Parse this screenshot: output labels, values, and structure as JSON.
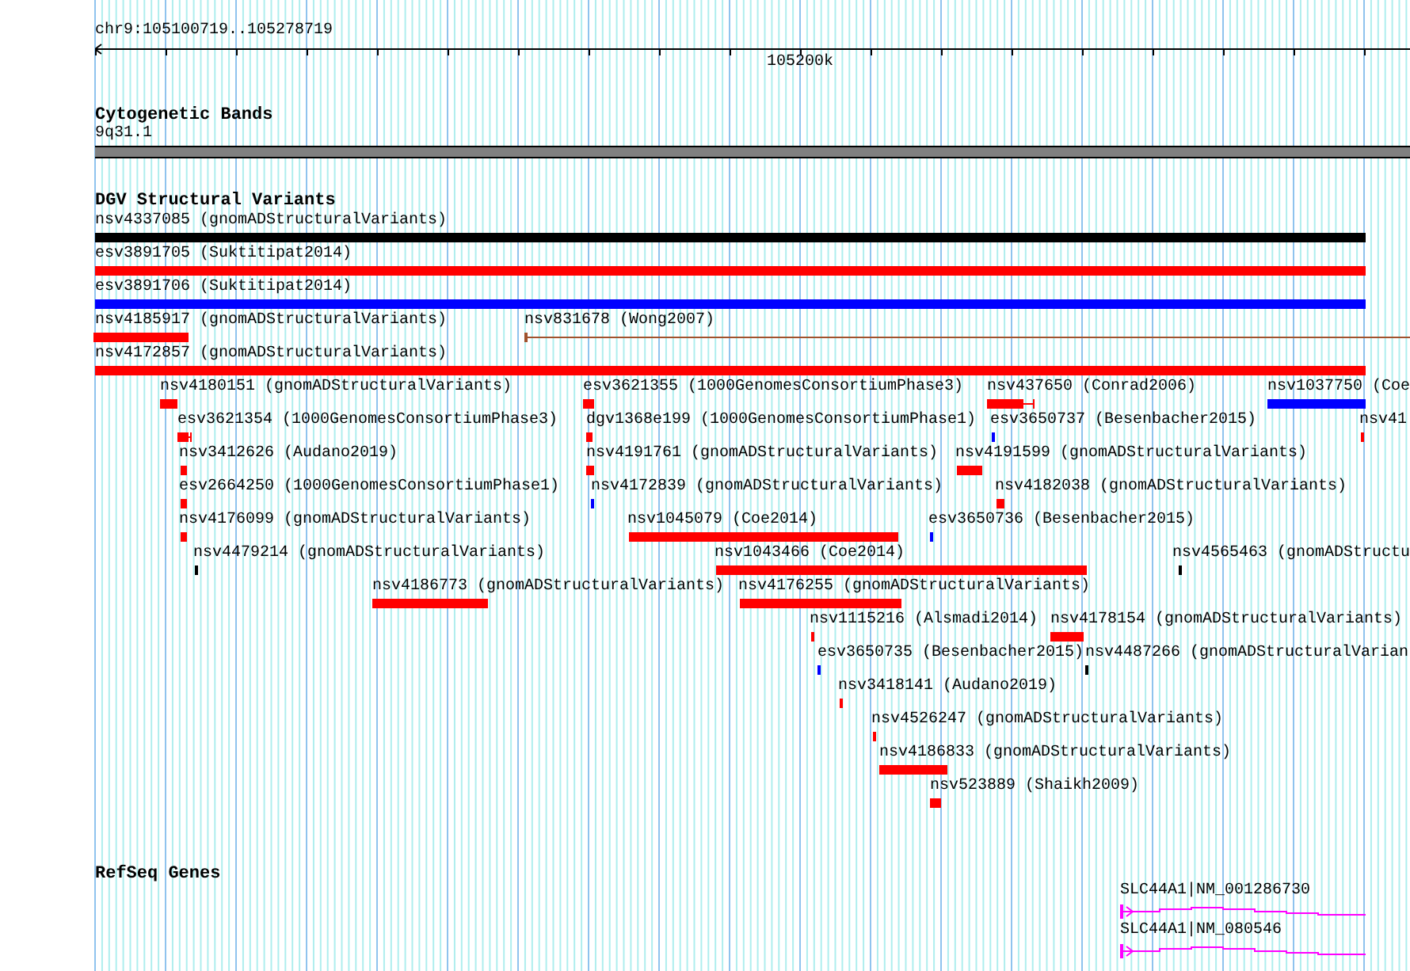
{
  "ruler": {
    "location": "chr9:105100719..105278719",
    "tick_label": "105200k"
  },
  "tracks": [
    {
      "title": "Cytogenetic Bands",
      "kind": "bands",
      "features": [
        {
          "label": "9q31.1"
        }
      ]
    },
    {
      "title": "DGV Structural Variants",
      "kind": "variants",
      "features": [
        {
          "label": "nsv4337085 (gnomADStructuralVariants)",
          "color": "#000000",
          "kind": "bar"
        },
        {
          "label": "esv3891705 (Suktitipat2014)",
          "color": "#ff0000",
          "kind": "bar"
        },
        {
          "label": "esv3891706 (Suktitipat2014)",
          "color": "#0000ff",
          "kind": "bar"
        },
        {
          "label": "nsv4185917 (gnomADStructuralVariants)",
          "color": "#ff0000",
          "kind": "bar"
        },
        {
          "label": "nsv831678 (Wong2007)",
          "color": "#a0522d",
          "kind": "line"
        },
        {
          "label": "nsv4172857 (gnomADStructuralVariants)",
          "color": "#ff0000",
          "kind": "bar"
        },
        {
          "label": "nsv4180151 (gnomADStructuralVariants)",
          "color": "#ff0000",
          "kind": "bar"
        },
        {
          "label": "esv3621355 (1000GenomesConsortiumPhase3)",
          "color": "#ff0000",
          "kind": "bar"
        },
        {
          "label": "nsv437650 (Conrad2006)",
          "color": "#ff0000",
          "kind": "whisker"
        },
        {
          "label": "nsv1037750 (Coe",
          "color": "#0000ff",
          "kind": "bar"
        },
        {
          "label": "esv3621354 (1000GenomesConsortiumPhase3)",
          "color": "#ff0000",
          "kind": "whisker"
        },
        {
          "label": "dgv1368e199 (1000GenomesConsortiumPhase1)",
          "color": "#ff0000",
          "kind": "bar"
        },
        {
          "label": "esv3650737 (Besenbacher2015)",
          "color": "#0000ff",
          "kind": "bar"
        },
        {
          "label": "nsv41",
          "color": "#ff0000",
          "kind": "bar"
        },
        {
          "label": "nsv3412626 (Audano2019)",
          "color": "#ff0000",
          "kind": "bar"
        },
        {
          "label": "nsv4191761 (gnomADStructuralVariants)",
          "color": "#ff0000",
          "kind": "bar"
        },
        {
          "label": "nsv4191599 (gnomADStructuralVariants)",
          "color": "#ff0000",
          "kind": "bar"
        },
        {
          "label": "esv2664250 (1000GenomesConsortiumPhase1)",
          "color": "#ff0000",
          "kind": "bar"
        },
        {
          "label": "nsv4172839 (gnomADStructuralVariants)",
          "color": "#0000ff",
          "kind": "bar"
        },
        {
          "label": "nsv4182038 (gnomADStructuralVariants)",
          "color": "#ff0000",
          "kind": "bar"
        },
        {
          "label": "nsv4176099 (gnomADStructuralVariants)",
          "color": "#ff0000",
          "kind": "bar"
        },
        {
          "label": "nsv1045079 (Coe2014)",
          "color": "#ff0000",
          "kind": "bar"
        },
        {
          "label": "esv3650736 (Besenbacher2015)",
          "color": "#0000ff",
          "kind": "bar"
        },
        {
          "label": "nsv4479214 (gnomADStructuralVariants)",
          "color": "#000000",
          "kind": "bar"
        },
        {
          "label": "nsv1043466 (Coe2014)",
          "color": "#ff0000",
          "kind": "bar"
        },
        {
          "label": "nsv4565463 (gnomADStructu",
          "color": "#000000",
          "kind": "bar"
        },
        {
          "label": "nsv4186773 (gnomADStructuralVariants)",
          "color": "#ff0000",
          "kind": "bar"
        },
        {
          "label": "nsv4176255 (gnomADStructuralVariants)",
          "color": "#ff0000",
          "kind": "bar"
        },
        {
          "label": "nsv1115216 (Alsmadi2014)",
          "color": "#ff0000",
          "kind": "bar"
        },
        {
          "label": "nsv4178154 (gnomADStructuralVariants)",
          "color": "#ff0000",
          "kind": "bar"
        },
        {
          "label": "esv3650735 (Besenbacher2015)",
          "color": "#0000ff",
          "kind": "bar"
        },
        {
          "label": "nsv4487266 (gnomADStructuralVarian",
          "color": "#000000",
          "kind": "bar"
        },
        {
          "label": "nsv3418141 (Audano2019)",
          "color": "#ff0000",
          "kind": "bar"
        },
        {
          "label": "nsv4526247 (gnomADStructuralVariants)",
          "color": "#ff0000",
          "kind": "bar"
        },
        {
          "label": "nsv4186833 (gnomADStructuralVariants)",
          "color": "#ff0000",
          "kind": "bar"
        },
        {
          "label": "nsv523889 (Shaikh2009)",
          "color": "#ff0000",
          "kind": "bar"
        }
      ]
    },
    {
      "title": "RefSeq Genes",
      "kind": "genes",
      "features": [
        {
          "label": "SLC44A1|NM_001286730"
        },
        {
          "label": "SLC44A1|NM_080546"
        }
      ]
    }
  ]
}
